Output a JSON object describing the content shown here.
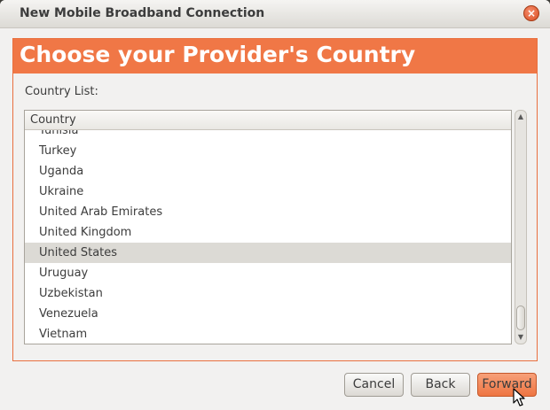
{
  "window": {
    "title": "New Mobile Broadband Connection",
    "close_icon": "×"
  },
  "banner": {
    "title": "Choose your Provider's Country"
  },
  "country_list": {
    "label": "Country List:",
    "column_header": "Country",
    "rows": [
      "Tunisia",
      "Turkey",
      "Uganda",
      "Ukraine",
      "United Arab Emirates",
      "United Kingdom",
      "United States",
      "Uruguay",
      "Uzbekistan",
      "Venezuela",
      "Vietnam"
    ],
    "selected": "United States"
  },
  "scrollbar": {
    "up_arrow": "▲",
    "down_arrow": "▼"
  },
  "buttons": {
    "cancel": "Cancel",
    "back": "Back",
    "forward": "Forward"
  },
  "colors": {
    "accent": "#f07746",
    "selection": "#dcdad5"
  }
}
